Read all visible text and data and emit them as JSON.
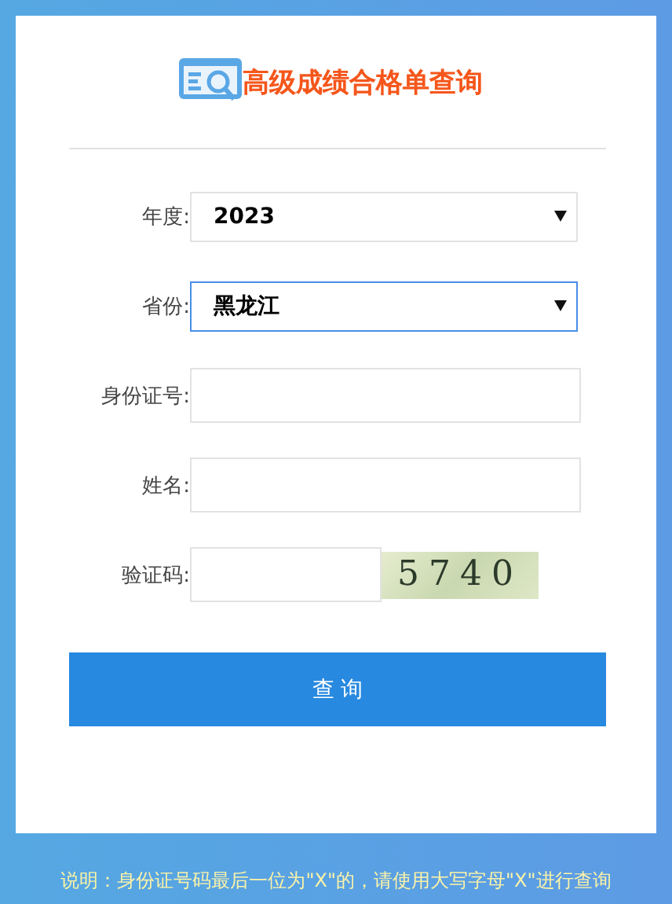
{
  "title": "高级成绩合格单查询",
  "fields": [
    {
      "kind": "select",
      "label": "年度:",
      "value": "2023",
      "focused": false
    },
    {
      "kind": "select",
      "label": "省份:",
      "value": "黑龙江",
      "focused": true
    },
    {
      "kind": "text",
      "label": "身份证号:",
      "focused": false
    },
    {
      "kind": "text",
      "label": "姓名:",
      "focused": false
    },
    {
      "kind": "captcha",
      "label": "验证码:",
      "captcha": "5740",
      "focused": false
    }
  ],
  "submit": "查 询",
  "note": "说明：身份证号码最后一位为\"X\"的，请使用大写字母\"X\"进行查询"
}
